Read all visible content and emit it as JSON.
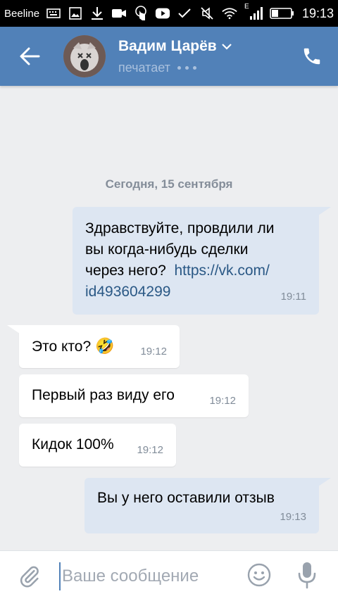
{
  "status_bar": {
    "carrier": "Beeline",
    "network": "E",
    "time": "19:13",
    "icons_left": [
      "keyboard-icon",
      "image-icon",
      "download-icon",
      "video-camera-icon",
      "touch-icon",
      "youtube-icon",
      "check-icon"
    ],
    "icons_right": [
      "mute-icon",
      "wifi-icon",
      "signal-icon",
      "battery-icon"
    ]
  },
  "header": {
    "contact_name": "Вадим Царёв",
    "status": "печатает"
  },
  "chat": {
    "date_separator": "Сегодня, 15 сентября",
    "messages": [
      {
        "direction": "out",
        "text": "Здравствуйте, провдили ли вы когда-нибудь сделки через него?",
        "link": "https://vk.com/id493604299",
        "link_part1": "https://vk.com/",
        "link_part2": "id493604299",
        "line1": "Здравствуйте, провдили ли",
        "line2": "вы когда-нибудь сделки",
        "line3": "через него?",
        "time": "19:11"
      },
      {
        "direction": "in",
        "text": "Это кто?",
        "emoji": "🤣",
        "time": "19:12"
      },
      {
        "direction": "in",
        "text": "Первый раз виду его",
        "time": "19:12"
      },
      {
        "direction": "in",
        "text": "Кидок 100%",
        "time": "19:12"
      },
      {
        "direction": "out",
        "text": "Вы у него оставили отзыв",
        "time": "19:13"
      }
    ]
  },
  "composer": {
    "placeholder": "Ваше сообщение"
  },
  "colors": {
    "header_bg": "#5181b8",
    "outgoing_bubble": "#dde6f2",
    "incoming_bubble": "#ffffff",
    "link": "#2a5885"
  }
}
